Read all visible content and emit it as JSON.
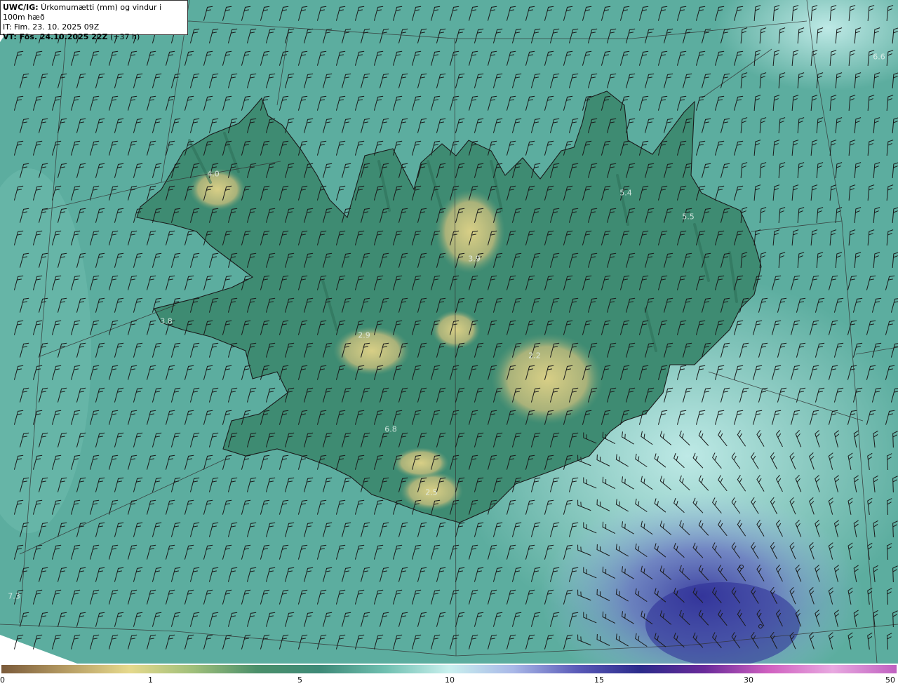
{
  "info": {
    "title_bold": "UWC/IG:",
    "title_rest": " Úrkomumætti (mm) og vindur i 100m hæð",
    "it_line": "IT: Fim. 23. 10. 2025 09Z",
    "vt_bold": "VT: Fös. 24.10.2025 22Z",
    "vt_rest": " (+37 h)"
  },
  "map_labels": [
    {
      "text": "6.6",
      "lon": 1253,
      "lat": 81
    },
    {
      "text": "4.0",
      "lon": 304,
      "lat": 248
    },
    {
      "text": "5.4",
      "lon": 892,
      "lat": 275
    },
    {
      "text": "5.5",
      "lon": 981,
      "lat": 309
    },
    {
      "text": "3.9",
      "lon": 676,
      "lat": 369
    },
    {
      "text": "3.8",
      "lon": 237,
      "lat": 458
    },
    {
      "text": "2.9",
      "lon": 519,
      "lat": 478
    },
    {
      "text": "2.2",
      "lon": 762,
      "lat": 507
    },
    {
      "text": "6.8",
      "lon": 557,
      "lat": 612
    },
    {
      "text": "2.5",
      "lon": 615,
      "lat": 702
    },
    {
      "text": "7.3",
      "lon": 20,
      "lat": 850
    }
  ],
  "legend": {
    "ticks": [
      {
        "label": "0",
        "value": 0
      },
      {
        "label": "1",
        "value": 1
      },
      {
        "label": "5",
        "value": 5
      },
      {
        "label": "10",
        "value": 10
      },
      {
        "label": "15",
        "value": 15
      },
      {
        "label": "30",
        "value": 30
      },
      {
        "label": "50",
        "value": 50
      }
    ],
    "colors": [
      "#7a5a3a",
      "#b59b62",
      "#e6d98c",
      "#9fbf7a",
      "#4a8f6a",
      "#3e8a78",
      "#6fbfb0",
      "#c9f0ee",
      "#a9b8e8",
      "#5a5ab8",
      "#2a2a8a",
      "#6a2a9a",
      "#d060c0",
      "#e8a8e0",
      "#c060c0"
    ]
  },
  "colors": {
    "sea": "#5fb3a3",
    "land": "#3d8a72",
    "highland": "#c9c67e",
    "rain": "#5a5fb0",
    "coast": "#1a1a1a"
  }
}
